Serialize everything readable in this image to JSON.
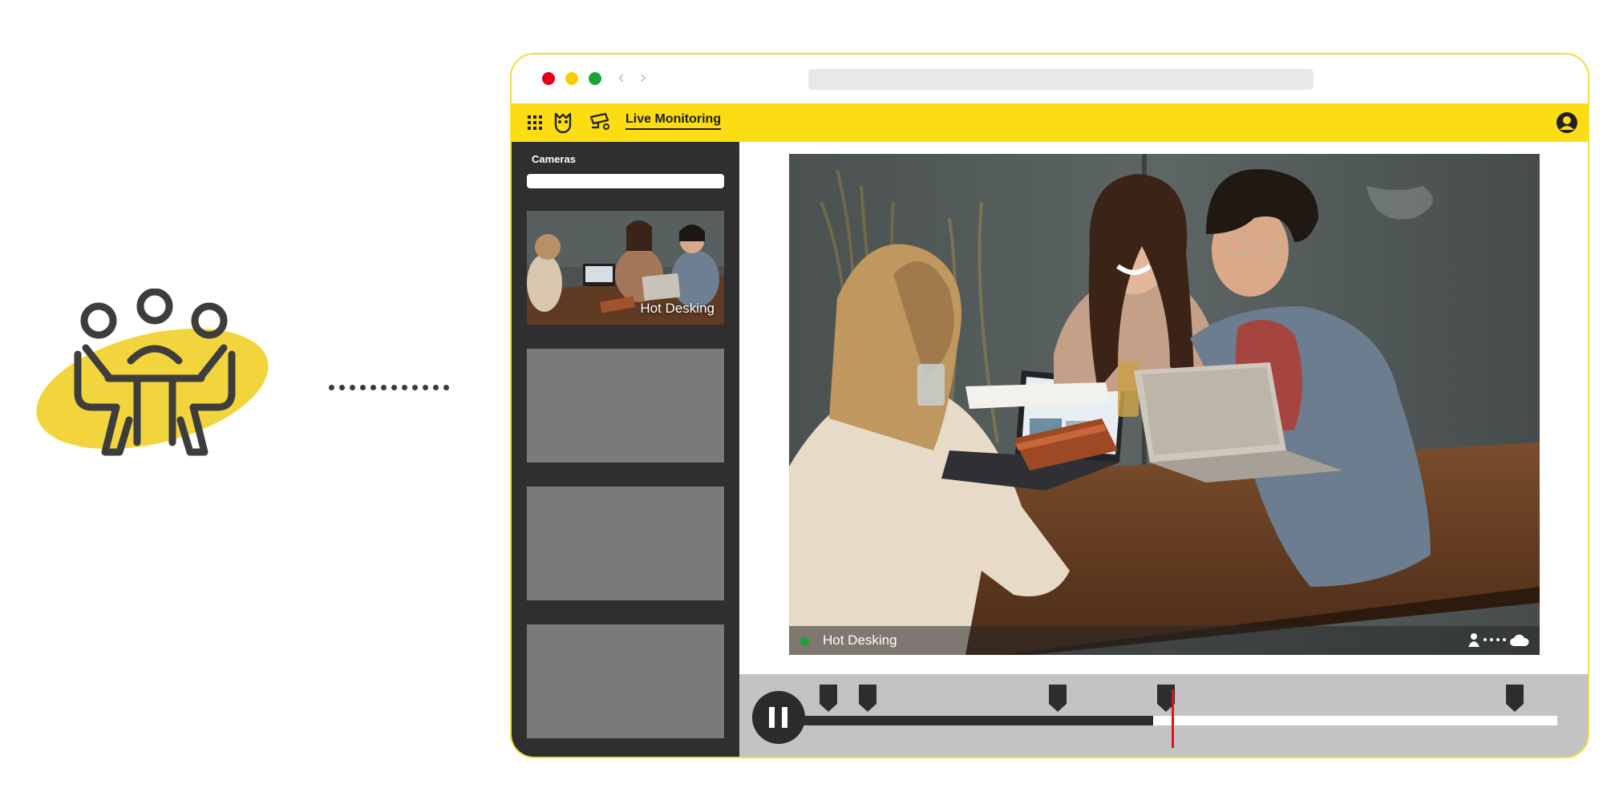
{
  "illustration": {
    "icon": "meeting-people-icon",
    "blob_color": "#f2d53c",
    "stroke_color": "#3d3d3d"
  },
  "browser": {
    "traffic_lights": [
      "#e4001b",
      "#f5cf00",
      "#1aa33b"
    ],
    "nav_arrows": "‹ ›",
    "accent": "#fcdc12"
  },
  "app_bar": {
    "apps_icon": "grid-icon",
    "logo_icon": "owl-logo-icon",
    "camera_icon": "security-camera-icon",
    "active_tab": "Live Monitoring",
    "account_icon": "user-account-icon"
  },
  "sidebar": {
    "title": "Cameras",
    "search_placeholder": "",
    "cameras": [
      {
        "label": "Hot Desking",
        "active": true
      },
      {
        "label": "",
        "active": false
      },
      {
        "label": "",
        "active": false
      },
      {
        "label": "",
        "active": false
      }
    ]
  },
  "player": {
    "camera_name": "Hot Desking",
    "status_color": "#1aa33b",
    "status_icons": [
      "person-icon",
      "cloud-icon"
    ],
    "pause_icon": "pause-icon",
    "progress": 0.45,
    "playhead_color": "#e10f1e",
    "event_markers": 5
  }
}
